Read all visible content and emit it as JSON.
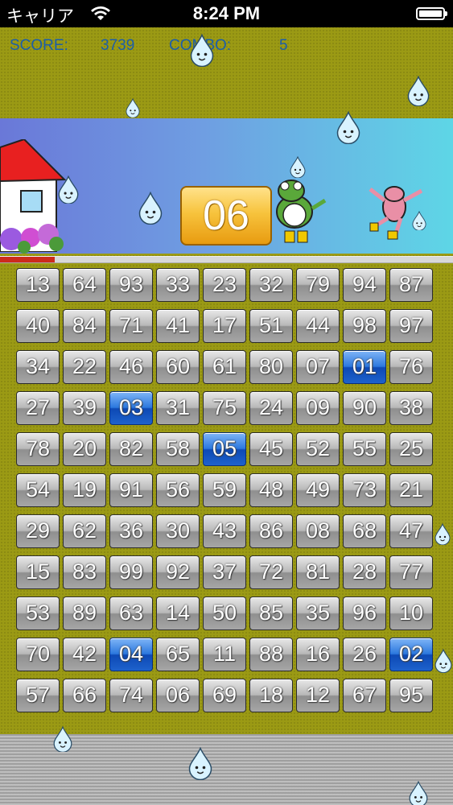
{
  "status_bar": {
    "carrier": "キャリア",
    "time": "8:24 PM"
  },
  "hud": {
    "score_label": "SCORE:",
    "score_value": "3739",
    "combo_label": "COMBO:",
    "combo_value": "5"
  },
  "target_number": "06",
  "timer_progress": 0.12,
  "colors": {
    "field": "#9b9a14",
    "selected_tile": "#2c78de",
    "timer_fill": "#cc2b1d"
  },
  "grid": {
    "columns": 9,
    "tiles": [
      "13",
      "64",
      "93",
      "33",
      "23",
      "32",
      "79",
      "94",
      "87",
      "40",
      "84",
      "71",
      "41",
      "17",
      "51",
      "44",
      "98",
      "97",
      "34",
      "22",
      "46",
      "60",
      "61",
      "80",
      "07",
      "01",
      "76",
      "27",
      "39",
      "03",
      "31",
      "75",
      "24",
      "09",
      "90",
      "38",
      "78",
      "20",
      "82",
      "58",
      "05",
      "45",
      "52",
      "55",
      "25",
      "54",
      "19",
      "91",
      "56",
      "59",
      "48",
      "49",
      "73",
      "21",
      "29",
      "62",
      "36",
      "30",
      "43",
      "86",
      "08",
      "68",
      "47",
      "15",
      "83",
      "99",
      "92",
      "37",
      "72",
      "81",
      "28",
      "77",
      "53",
      "89",
      "63",
      "14",
      "50",
      "85",
      "35",
      "96",
      "10",
      "70",
      "42",
      "04",
      "65",
      "11",
      "88",
      "16",
      "26",
      "02",
      "57",
      "66",
      "74",
      "06",
      "69",
      "18",
      "12",
      "67",
      "95"
    ],
    "selected": [
      "01",
      "03",
      "05",
      "04",
      "02"
    ]
  },
  "icons": [
    "wifi-icon",
    "battery-icon",
    "house-icon",
    "frog-icon",
    "frog-jumping-icon",
    "raindrop-icon",
    "flowers-icon"
  ]
}
